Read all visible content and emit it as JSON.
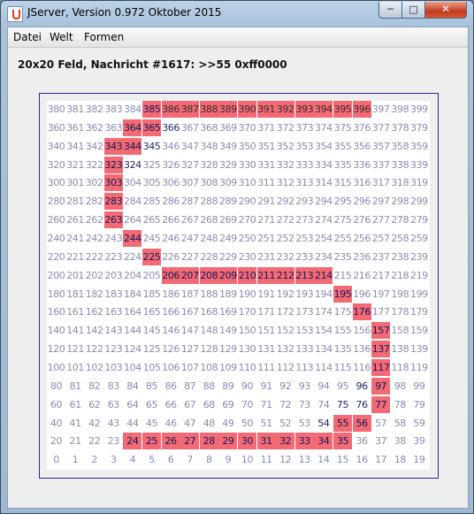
{
  "window": {
    "title": "JServer, Version 0.972 Oktober 2015",
    "minimize_glyph": "─",
    "maximize_glyph": "□",
    "close_glyph": "✕",
    "icon": "java-app-icon"
  },
  "menu": {
    "items": [
      "Datei",
      "Welt",
      "Formen"
    ]
  },
  "status": {
    "text": "20x20 Feld, Nachricht #1617: >>55 0xff0000"
  },
  "grid": {
    "columns": 20,
    "rows": 20,
    "numbering": "cell index = row*20 + column, row 0 at bottom",
    "highlight_color": "#ff0000",
    "highlighted_cells": [
      385,
      386,
      387,
      388,
      389,
      390,
      391,
      392,
      393,
      394,
      395,
      396,
      364,
      365,
      343,
      344,
      323,
      303,
      283,
      263,
      244,
      225,
      206,
      207,
      208,
      209,
      210,
      211,
      212,
      213,
      214,
      195,
      176,
      157,
      137,
      117,
      97,
      77,
      56,
      55,
      35,
      34,
      33,
      32,
      31,
      30,
      29,
      28,
      27,
      26,
      25,
      24
    ],
    "dark_text_cells": [
      364,
      365,
      366,
      343,
      344,
      345,
      323,
      324,
      303,
      283,
      263,
      244,
      225,
      206,
      207,
      208,
      209,
      210,
      211,
      212,
      213,
      214,
      195,
      176,
      157,
      137,
      117,
      97,
      96,
      77,
      76,
      75,
      56,
      55,
      54,
      35,
      34,
      33,
      32,
      31,
      30,
      29,
      28,
      27,
      26,
      25,
      24,
      385
    ]
  }
}
